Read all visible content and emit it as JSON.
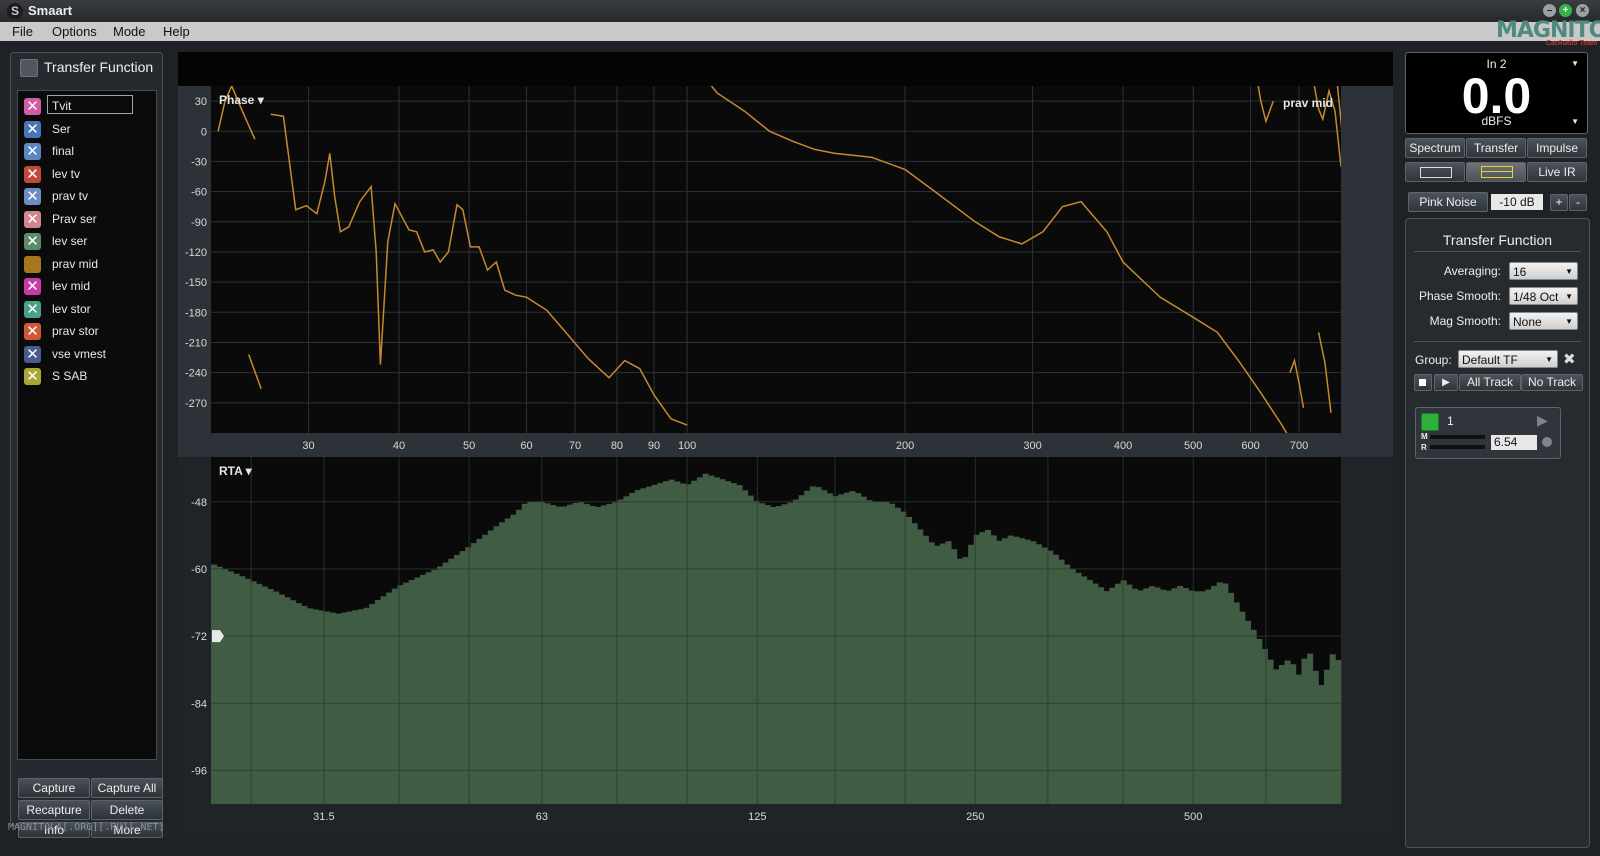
{
  "window": {
    "title": "Smaart",
    "logo_text": "MAGNITOLA",
    "logo_sub": "CarAudio Team"
  },
  "menu": [
    "File",
    "Options",
    "Mode",
    "Help"
  ],
  "left_panel": {
    "title": "Transfer Function",
    "edit_value": "Tvit",
    "traces": [
      {
        "label": "Tvit",
        "color": "#d45ba6",
        "icon": "x-icon"
      },
      {
        "label": "Ser",
        "color": "#4a74b8",
        "icon": "x-icon"
      },
      {
        "label": "final",
        "color": "#5c86c2",
        "icon": "x-icon"
      },
      {
        "label": "lev tv",
        "color": "#c04a3c",
        "icon": "x-icon"
      },
      {
        "label": "prav tv",
        "color": "#6d8cc4",
        "icon": "x-icon"
      },
      {
        "label": "Prav ser",
        "color": "#d2868c",
        "icon": "x-icon"
      },
      {
        "label": "lev ser",
        "color": "#5d8a6c",
        "icon": "x-icon"
      },
      {
        "label": "prav mid",
        "color": "#a8761c",
        "icon": "swatch"
      },
      {
        "label": "lev mid",
        "color": "#c83aa8",
        "icon": "x-icon"
      },
      {
        "label": "lev stor",
        "color": "#4aa08a",
        "icon": "x-icon"
      },
      {
        "label": "prav stor",
        "color": "#d0583a",
        "icon": "x-icon"
      },
      {
        "label": "vse vmest",
        "color": "#4a5c8c",
        "icon": "x-icon"
      },
      {
        "label": "S SAB",
        "color": "#a8a838",
        "icon": "x-icon"
      }
    ],
    "buttons": {
      "capture": "Capture",
      "capture_all": "Capture All",
      "recapture": "Recapture",
      "delete": "Delete",
      "info": "Info",
      "more": "More"
    },
    "watermark": "MAGNITOLA[.ORG][.RU][.NET]"
  },
  "phase_plot": {
    "label": "Phase ▾",
    "trace_name": "prav mid",
    "trace_color": "#c58a2c"
  },
  "rta_plot": {
    "label": "RTA ▾",
    "fill_color": "#405c42"
  },
  "chart_data": [
    {
      "type": "line",
      "title": "Phase",
      "xscale": "log",
      "xlim": [
        22,
        800
      ],
      "ylim": [
        -300,
        45
      ],
      "yticks": [
        30,
        0,
        -30,
        -60,
        -90,
        -120,
        -150,
        -180,
        -210,
        -240,
        -270
      ],
      "xticks": [
        30,
        40,
        50,
        60,
        70,
        80,
        90,
        100,
        200,
        300,
        400,
        500,
        600,
        700
      ],
      "grid": true,
      "series": [
        {
          "name": "prav mid",
          "color": "#c58a2c",
          "segments": [
            [
              [
                22.5,
                0
              ],
              [
                23,
                30
              ],
              [
                23.5,
                45
              ],
              [
                24.3,
                20
              ],
              [
                25.3,
                -8
              ]
            ],
            [
              [
                24.8,
                -222
              ],
              [
                25.8,
                -256
              ]
            ],
            [
              [
                26.6,
                17
              ],
              [
                27.7,
                15
              ],
              [
                28.8,
                -78
              ],
              [
                29.8,
                -74
              ],
              [
                30.8,
                -82
              ],
              [
                31.6,
                -50
              ],
              [
                32.1,
                -22
              ],
              [
                32.6,
                -65
              ],
              [
                33.2,
                -100
              ],
              [
                34.1,
                -95
              ],
              [
                35.3,
                -70
              ],
              [
                36.6,
                -55
              ],
              [
                37.2,
                -120
              ],
              [
                37.7,
                -232
              ],
              [
                38.6,
                -110
              ],
              [
                39.5,
                -72
              ],
              [
                41.3,
                -98
              ],
              [
                42.3,
                -100
              ],
              [
                43.4,
                -120
              ],
              [
                44.6,
                -118
              ],
              [
                45.6,
                -130
              ],
              [
                46.8,
                -120
              ],
              [
                48.1,
                -73
              ],
              [
                49.0,
                -78
              ],
              [
                50.2,
                -115
              ],
              [
                51.6,
                -115
              ],
              [
                53.0,
                -138
              ],
              [
                54.5,
                -130
              ],
              [
                56.0,
                -158
              ],
              [
                58.0,
                -163
              ],
              [
                60.0,
                -165
              ],
              [
                64.0,
                -178
              ],
              [
                68.0,
                -200
              ],
              [
                73.0,
                -226
              ],
              [
                78.0,
                -245
              ],
              [
                82.0,
                -228
              ],
              [
                86.0,
                -236
              ],
              [
                90.0,
                -262
              ],
              [
                95.0,
                -286
              ],
              [
                100.0,
                -292
              ]
            ],
            [
              [
                104,
                60
              ],
              [
                110,
                38
              ],
              [
                120,
                20
              ],
              [
                130,
                0
              ],
              [
                140,
                -10
              ],
              [
                150,
                -18
              ],
              [
                160,
                -22
              ],
              [
                170,
                -24
              ],
              [
                180,
                -26
              ],
              [
                200,
                -38
              ],
              [
                220,
                -60
              ],
              [
                250,
                -90
              ],
              [
                270,
                -105
              ],
              [
                290,
                -112
              ],
              [
                310,
                -100
              ],
              [
                330,
                -75
              ],
              [
                350,
                -70
              ],
              [
                380,
                -100
              ],
              [
                400,
                -130
              ],
              [
                450,
                -165
              ],
              [
                500,
                -185
              ],
              [
                540,
                -200
              ],
              [
                580,
                -230
              ],
              [
                620,
                -260
              ],
              [
                660,
                -290
              ],
              [
                700,
                -320
              ]
            ],
            [
              [
                610,
                60
              ],
              [
                620,
                30
              ],
              [
                630,
                10
              ],
              [
                645,
                30
              ]
            ],
            [
              [
                680,
                -240
              ],
              [
                690,
                -228
              ],
              [
                700,
                -250
              ],
              [
                710,
                -275
              ]
            ],
            [
              [
                735,
                45
              ],
              [
                745,
                22
              ],
              [
                755,
                12
              ],
              [
                770,
                40
              ],
              [
                785,
                20
              ],
              [
                800,
                -35
              ]
            ],
            [
              [
                745,
                -200
              ],
              [
                760,
                -230
              ],
              [
                775,
                -280
              ]
            ],
            [
              [
                790,
                50
              ],
              [
                800,
                10
              ],
              [
                815,
                -60
              ],
              [
                830,
                -90
              ],
              [
                840,
                -110
              ]
            ]
          ]
        }
      ]
    },
    {
      "type": "area",
      "title": "RTA",
      "xscale": "log",
      "xlim": [
        22,
        800
      ],
      "ylim": [
        -102,
        -40
      ],
      "yticks": [
        -48,
        -60,
        -72,
        -84,
        -96
      ],
      "xticks": [
        31.5,
        63,
        125,
        250,
        500
      ],
      "grid": true,
      "x": [
        22,
        24,
        27,
        30,
        33,
        36,
        40,
        45,
        50,
        55,
        58,
        60,
        63,
        67,
        71,
        75,
        80,
        85,
        90,
        95,
        100,
        106,
        112,
        118,
        125,
        132,
        140,
        150,
        160,
        170,
        180,
        190,
        200,
        210,
        220,
        230,
        240,
        250,
        260,
        270,
        280,
        300,
        320,
        340,
        360,
        380,
        400,
        420,
        440,
        460,
        480,
        500,
        520,
        550,
        580,
        620,
        650,
        680,
        700,
        720,
        750,
        780,
        800
      ],
      "values": [
        -59,
        -61,
        -64,
        -67,
        -68,
        -67,
        -63,
        -60,
        -56,
        -52,
        -50,
        -48,
        -48,
        -49,
        -48,
        -49,
        -48,
        -46,
        -45,
        -44,
        -45,
        -43,
        -44,
        -45,
        -48,
        -49,
        -48,
        -45,
        -47,
        -46,
        -48,
        -48,
        -50,
        -53,
        -56,
        -55,
        -59,
        -54,
        -53,
        -55,
        -54,
        -55,
        -57,
        -60,
        -62,
        -64,
        -62,
        -64,
        -63,
        -64,
        -63,
        -64,
        -64,
        -62,
        -67,
        -73,
        -78,
        -76,
        -79,
        -74,
        -81,
        -75,
        -77
      ]
    }
  ],
  "right_panel": {
    "meter": {
      "channel": "In 2",
      "value": "0.0",
      "unit": "dBFS"
    },
    "tabs": [
      "Spectrum",
      "Transfer",
      "Impulse"
    ],
    "live_ir": "Live IR",
    "pink_noise": "Pink Noise",
    "noise_level": "-10 dB",
    "plus": "+",
    "minus": "-",
    "tf": {
      "title": "Transfer Function",
      "averaging_label": "Averaging:",
      "averaging_value": "16",
      "phase_smooth_label": "Phase Smooth:",
      "phase_smooth_value": "1/48 Oct",
      "mag_smooth_label": "Mag Smooth:",
      "mag_smooth_value": "None",
      "group_label": "Group:",
      "group_value": "Default TF",
      "all_track": "All Track",
      "no_track": "No Track",
      "engine_number": "1",
      "m_label": "M",
      "r_label": "R",
      "delay_value": "6.54"
    }
  }
}
